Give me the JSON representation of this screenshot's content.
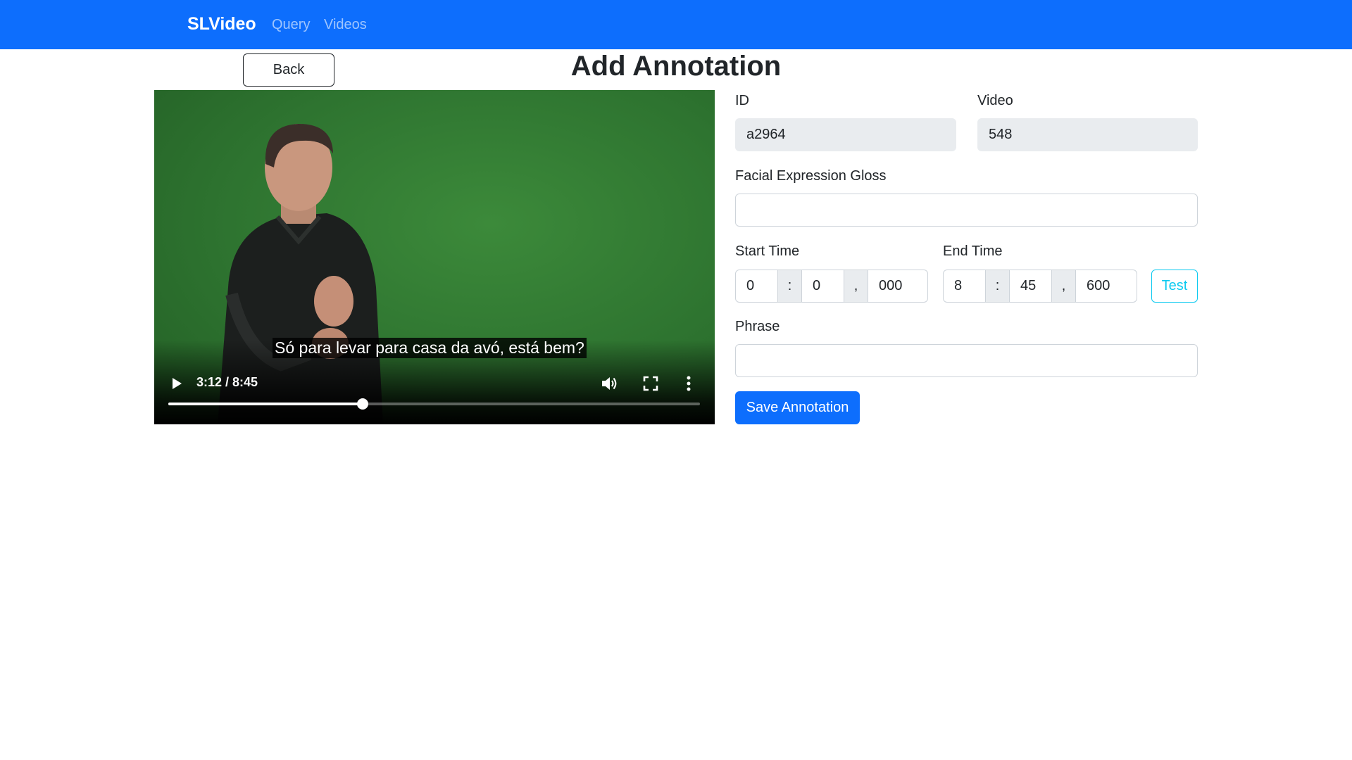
{
  "navbar": {
    "brand": "SLVideo",
    "links": [
      "Query",
      "Videos"
    ]
  },
  "page": {
    "back_label": "Back",
    "title": "Add Annotation"
  },
  "player": {
    "subtitle": "Só para levar para casa da avó, está bem?",
    "time": "3:12 / 8:45",
    "progress_fraction": 0.366
  },
  "form": {
    "id_label": "ID",
    "id_value": "a2964",
    "video_label": "Video",
    "video_value": "548",
    "facial_label": "Facial Expression Gloss",
    "facial_value": "",
    "start_label": "Start Time",
    "start": {
      "min": "0",
      "sec": "0",
      "ms": "000"
    },
    "end_label": "End Time",
    "end": {
      "min": "8",
      "sec": "45",
      "ms": "600"
    },
    "colon": ":",
    "comma": ",",
    "test_label": "Test",
    "phrase_label": "Phrase",
    "phrase_value": "",
    "save_label": "Save Annotation"
  },
  "colors": {
    "primary": "#0d6efd",
    "info": "#0dcaf0",
    "video_bg": "#2f7a2f"
  }
}
